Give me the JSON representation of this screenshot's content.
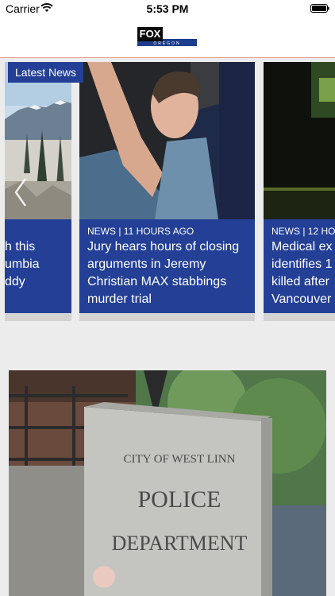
{
  "status_bar": {
    "carrier": "Carrier",
    "time": "5:53 PM"
  },
  "header": {
    "logo_text": "FOX",
    "logo_sub": "OREGON"
  },
  "carousel": {
    "badge": "Latest News",
    "cards": [
      {
        "meta": "",
        "title_lines": [
          "h this",
          "umbia",
          "ddy"
        ]
      },
      {
        "meta": "NEWS | 11 HOURS AGO",
        "title_lines": [
          "Jury hears hours of closing",
          "arguments in Jeremy",
          "Christian MAX stabbings",
          "murder trial"
        ]
      },
      {
        "meta": "NEWS | 12 HO",
        "title_lines": [
          "Medical ex",
          "identifies 1",
          "killed after",
          "Vancouver"
        ]
      }
    ]
  },
  "story": {
    "sign_lines": [
      "CITY OF WEST LINN",
      "POLICE",
      "DEPARTMENT"
    ]
  },
  "colors": {
    "accent_blue": "#233f96",
    "header_rule": "#e6a09a",
    "background": "#ececec"
  }
}
